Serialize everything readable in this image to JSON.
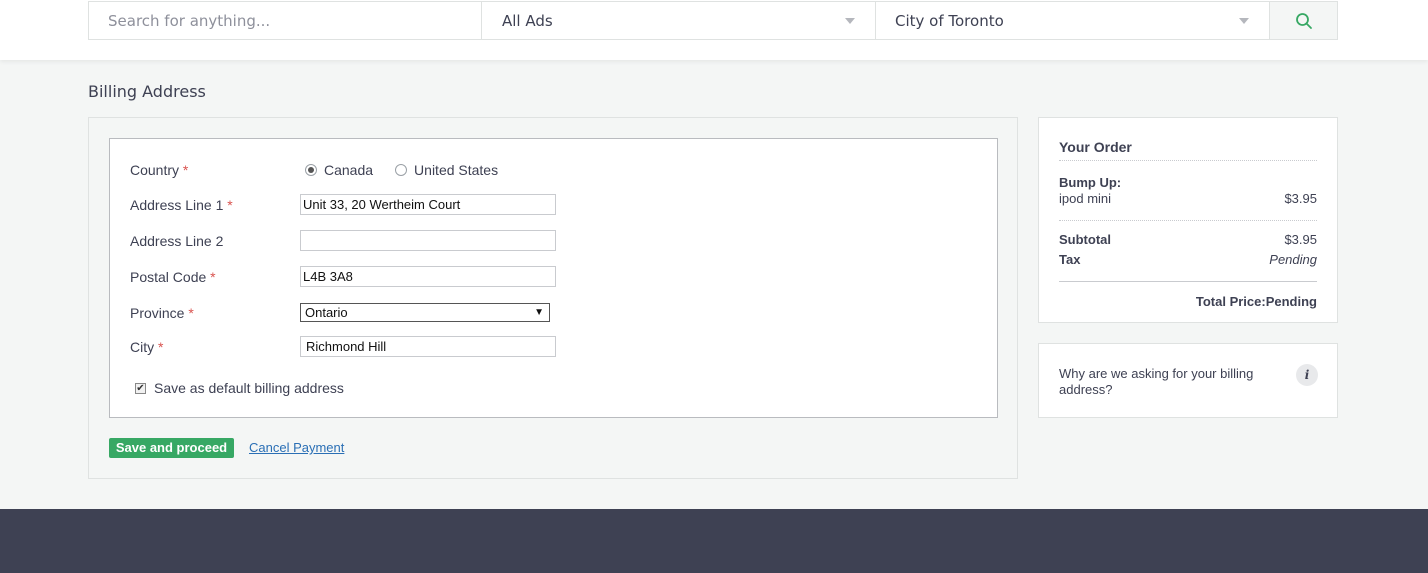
{
  "header": {
    "search_placeholder": "Search for anything...",
    "category": "All Ads",
    "location": "City of Toronto"
  },
  "page": {
    "title": "Billing Address"
  },
  "form": {
    "required_mark": "*",
    "country": {
      "label": "Country",
      "options": [
        "Canada",
        "United States"
      ],
      "selected": "Canada"
    },
    "address1": {
      "label": "Address Line 1",
      "value": "Unit 33, 20 Wertheim Court"
    },
    "address2": {
      "label": "Address Line 2",
      "value": ""
    },
    "postal": {
      "label": "Postal Code",
      "value": "L4B 3A8"
    },
    "province": {
      "label": "Province",
      "value": "Ontario"
    },
    "city": {
      "label": "City",
      "value": "Richmond Hill"
    },
    "save_default": {
      "label": "Save as default billing address",
      "checked": true
    }
  },
  "actions": {
    "save_label": "Save and proceed",
    "cancel_label": "Cancel Payment"
  },
  "order": {
    "title": "Your Order",
    "item_heading": "Bump Up:",
    "item_name": "ipod mini",
    "item_price": "$3.95",
    "subtotal_label": "Subtotal",
    "subtotal_value": "$3.95",
    "tax_label": "Tax",
    "tax_value": "Pending",
    "total_label": "Total Price:",
    "total_value": "Pending"
  },
  "info": {
    "text": "Why are we asking for your billing address?",
    "icon_glyph": "i"
  },
  "colors": {
    "accent_green": "#37a864",
    "footer": "#3e4153",
    "link": "#2a6fb5",
    "required": "#d9534f"
  }
}
